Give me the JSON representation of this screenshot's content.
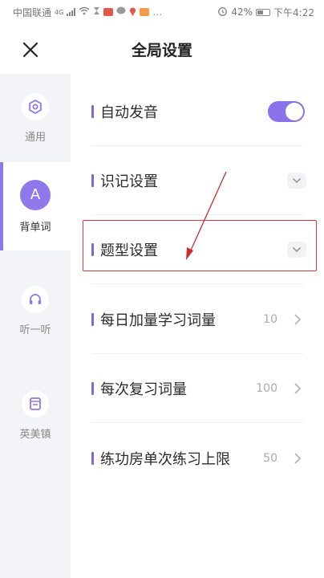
{
  "status_bar": {
    "carrier": "中国联通",
    "carrier_network": "4G",
    "battery": "42%",
    "time": "下午4:22"
  },
  "header": {
    "title": "全局设置",
    "close_icon": "close-icon"
  },
  "sidebar": {
    "items": [
      {
        "label": "通用",
        "icon": "settings-hex-icon",
        "active": false
      },
      {
        "label": "背单词",
        "icon": "letter-a-icon",
        "icon_text": "A",
        "active": true
      },
      {
        "label": "听一听",
        "icon": "headphones-icon",
        "active": false
      },
      {
        "label": "英美镇",
        "icon": "book-icon",
        "active": false
      }
    ]
  },
  "settings": [
    {
      "label": "自动发音",
      "control": "toggle",
      "value": true
    },
    {
      "label": "识记设置",
      "control": "dropdown"
    },
    {
      "label": "题型设置",
      "control": "dropdown",
      "highlighted": true
    },
    {
      "label": "每日加量学习词量",
      "control": "chevron",
      "value": "10"
    },
    {
      "label": "每次复习词量",
      "control": "chevron",
      "value": "100"
    },
    {
      "label": "练功房单次练习上限",
      "control": "chevron",
      "value": "50"
    }
  ],
  "colors": {
    "accent": "#8e78ec",
    "highlight": "#d23a3a",
    "sidebar_bg": "#f3f4f8"
  }
}
